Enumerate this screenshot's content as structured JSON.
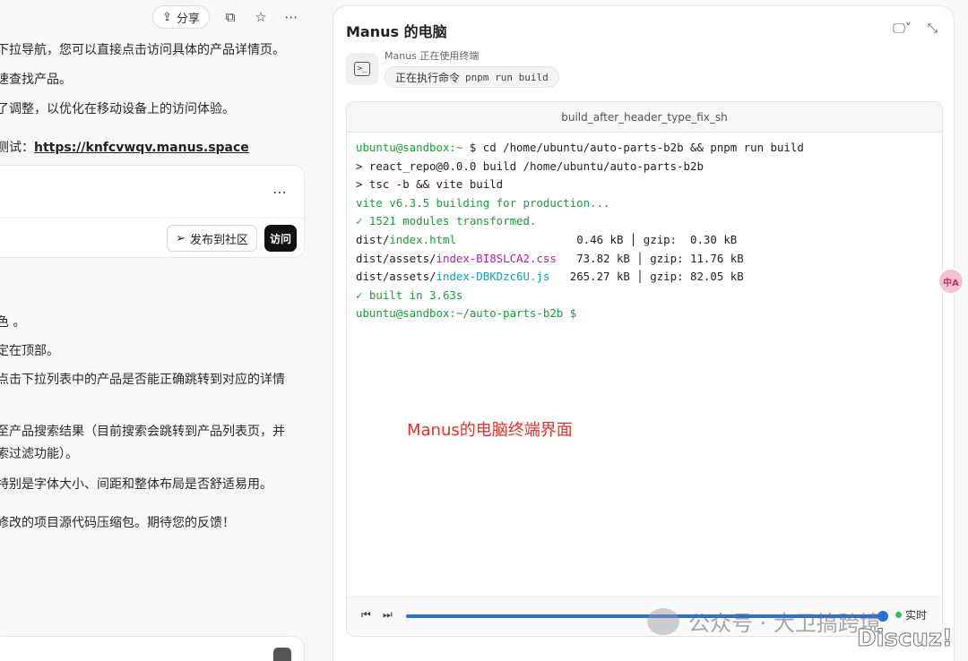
{
  "chat": {
    "share_label": "分享",
    "lines": [
      "下拉导航，您可以直接点击访问具体的产品详情页。",
      "速查找产品。",
      "了调整，以优化在移动设备上的访问体验。",
      "测试：",
      "色 。",
      "定在顶部。",
      "点击下拉列表中的产品是否能正确跳转到对应的详情",
      "至产品搜索结果（目前搜索会跳转到产品列表页，并",
      "索过滤功能）。",
      "特别是字体大小、间距和整体布局是否舒适易用。",
      "修改的项目源代码压缩包。期待您的反馈！"
    ],
    "test_link": "https://knfcvwqv.manus.space",
    "publish_label": "发布到社区",
    "visit_label": "访问"
  },
  "panel": {
    "title": "Manus 的电脑",
    "using_label": "Manus 正在使用终端",
    "chip_prefix": "正在执行命令",
    "chip_command": "pnpm run build",
    "terminal_title": "build_after_header_type_fix_sh",
    "annotation": "Manus的电脑终端界面",
    "live_label": "实时"
  },
  "terminal": {
    "prompt1": "ubuntu@sandbox:~",
    "cmd1": " $ cd /home/ubuntu/auto-parts-b2b && pnpm run build",
    "line2": "> react_repo@0.0.0 build /home/ubuntu/auto-parts-b2b",
    "line3": "> tsc -b && vite build",
    "line4": "vite v6.3.5 building for production...",
    "line5": "✓ 1521 modules transformed.",
    "f1_dir": "dist/",
    "f1_name": "index.html",
    "f1_stats": "                  0.46 kB │ gzip:  0.30 kB",
    "f2_dir": "dist/assets/",
    "f2_name": "index-BI8SLCA2.css",
    "f2_stats": "   73.82 kB │ gzip: 11.76 kB",
    "f3_dir": "dist/assets/",
    "f3_name": "index-DBKDzc6U.js",
    "f3_stats": "   265.27 kB │ gzip: 82.05 kB",
    "line9": "✓ built in 3.63s",
    "prompt2": "ubuntu@sandbox:~/auto-parts-b2b",
    "prompt2_tail": " $"
  },
  "overlay": {
    "side_badge": "中A",
    "watermark": "公众号 · 大卫搞跨境",
    "discuz": "Discuz!"
  }
}
